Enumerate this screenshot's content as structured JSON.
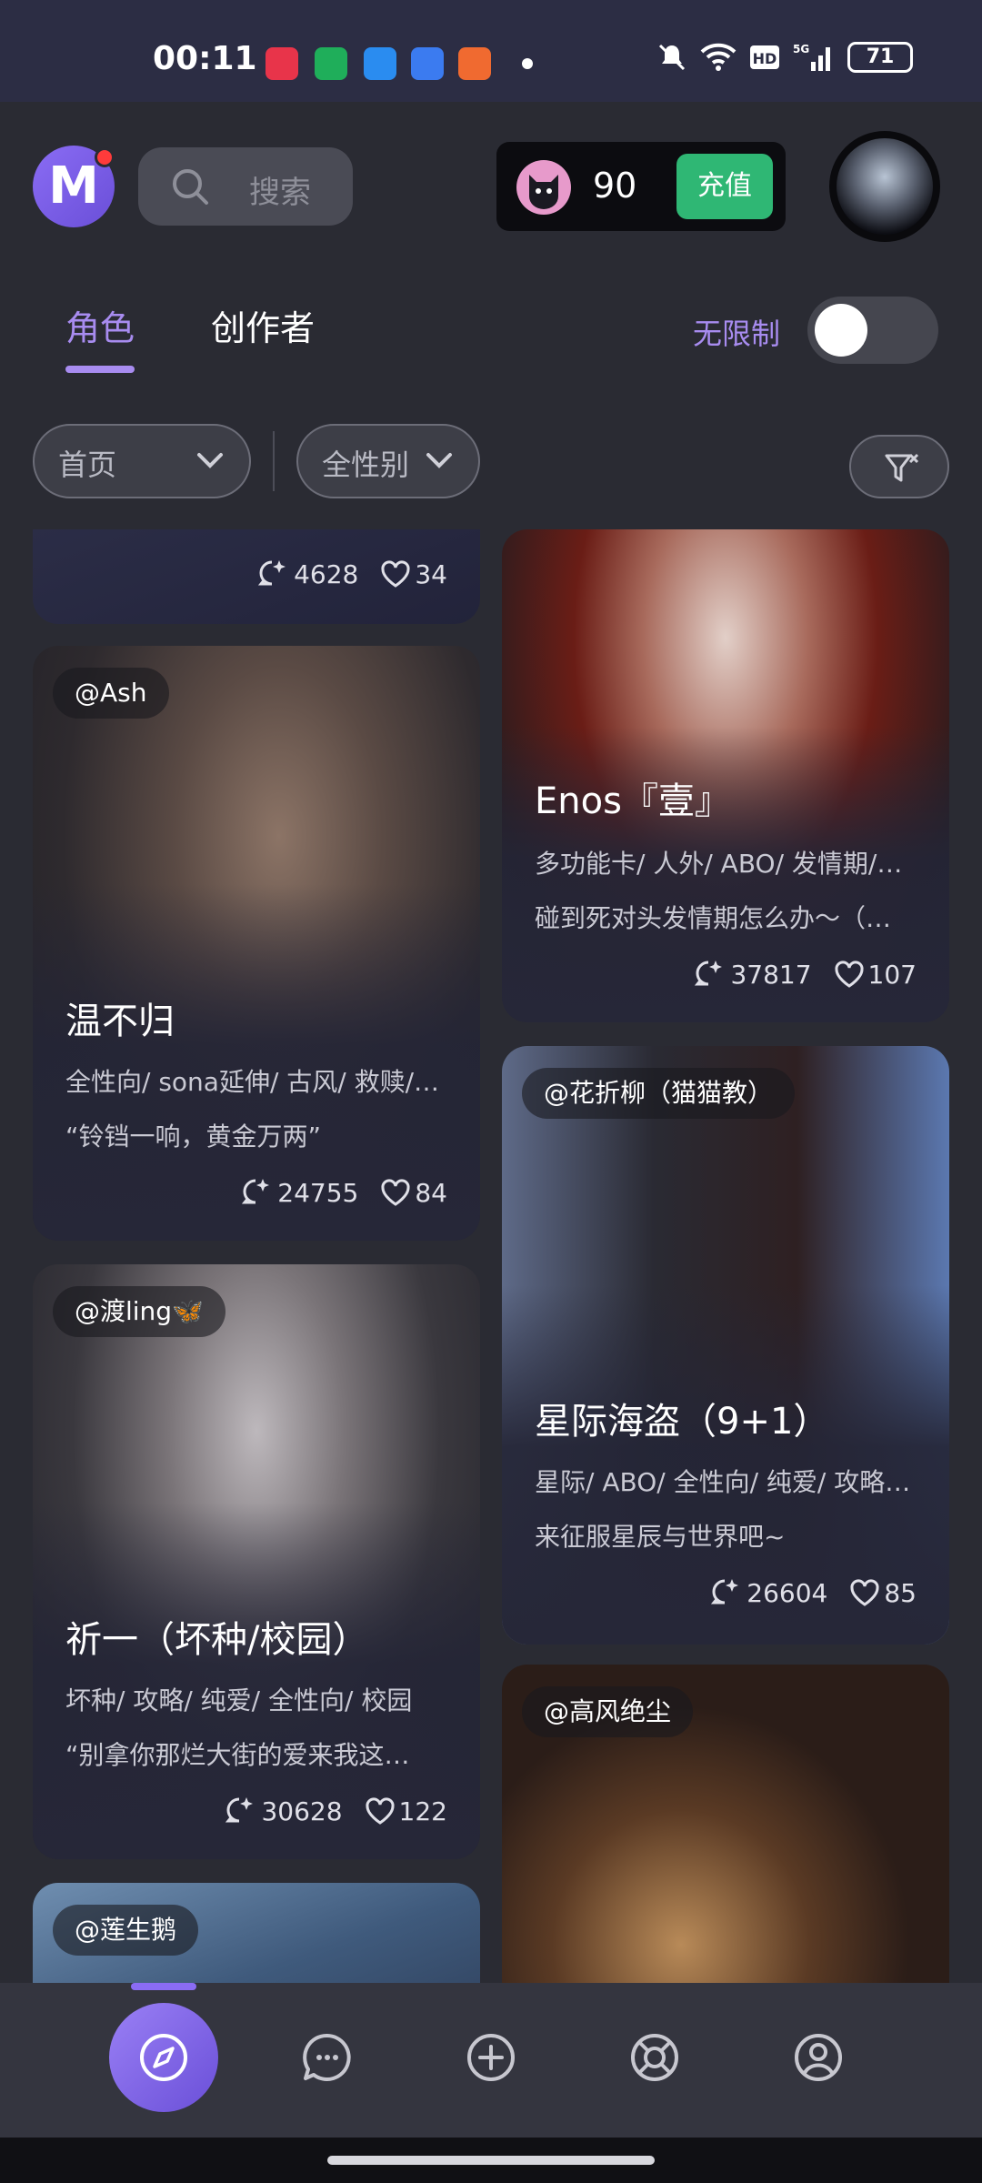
{
  "status_bar": {
    "time": "00:11",
    "battery": "71"
  },
  "header": {
    "search_placeholder": "搜索",
    "coin_count": "90",
    "recharge_label": "充值"
  },
  "tabs": {
    "active": "角色",
    "inactive": "创作者",
    "unlimited_label": "无限制"
  },
  "filters": {
    "category": "首页",
    "gender": "全性别"
  },
  "cards": [
    {
      "chats": "4628",
      "likes": "34"
    },
    {
      "author": "@Ash",
      "title": "温不归",
      "tags": "全性向/ sona延伸/ 古风/ 救赎/…",
      "desc": "“铃铛一响，黄金万两”",
      "chats": "24755",
      "likes": "84"
    },
    {
      "author": "@渡ling🦋",
      "title": "祈一（坏种/校园）",
      "tags": "坏种/ 攻略/ 纯爱/ 全性向/ 校园",
      "desc": "“别拿你那烂大街的爱来我这…",
      "chats": "30628",
      "likes": "122"
    },
    {
      "author": "@莲生鹅"
    },
    {
      "title": "Enos『壹』",
      "tags": "多功能卡/ 人外/ ABO/ 发情期/…",
      "desc": "碰到死对头发情期怎么办～（…",
      "chats": "37817",
      "likes": "107"
    },
    {
      "author": "@花折柳（猫猫教）",
      "title": "星际海盗（9+1）",
      "tags": "星际/ ABO/ 全性向/ 纯爱/ 攻略…",
      "desc": "来征服星辰与世界吧~",
      "chats": "26604",
      "likes": "85"
    },
    {
      "author": "@高风绝尘"
    }
  ],
  "colors": {
    "accent": "#a88cf0",
    "recharge": "#2fb774",
    "background": "#2a2b33"
  }
}
